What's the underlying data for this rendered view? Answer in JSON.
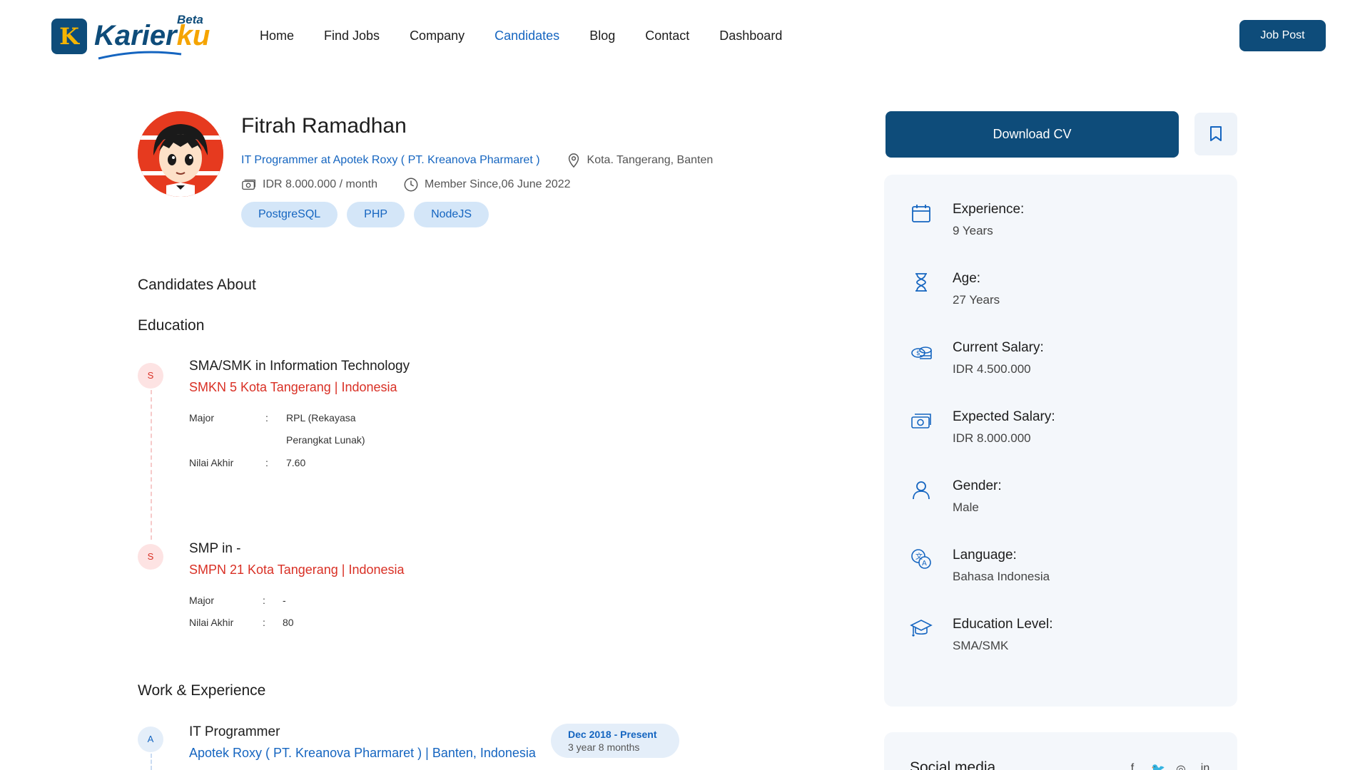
{
  "header": {
    "logo_letter": "K",
    "logo_text_main": "Karier",
    "logo_text_accent": "ku",
    "logo_beta": "Beta",
    "nav": [
      "Home",
      "Find Jobs",
      "Company",
      "Candidates",
      "Blog",
      "Contact",
      "Dashboard"
    ],
    "active_nav": "Candidates",
    "job_post_label": "Job Post"
  },
  "profile": {
    "name": "Fitrah Ramadhan",
    "role": "IT Programmer at Apotek Roxy ( PT. Kreanova Pharmaret )",
    "location": "Kota. Tangerang, Banten",
    "salary": "IDR 8.000.000 / month",
    "member_since": "Member Since,06 June 2022",
    "skills": [
      "PostgreSQL",
      "PHP",
      "NodeJS"
    ]
  },
  "sections": {
    "about": "Candidates About",
    "education": "Education",
    "work": "Work & Experience"
  },
  "education": [
    {
      "dot": "S",
      "title": "SMA/SMK in Information Technology",
      "school": "SMKN 5 Kota Tangerang | Indonesia",
      "major_label": "Major",
      "major_line1": "RPL (Rekayasa",
      "major_line2": "Perangkat Lunak)",
      "grade_label": "Nilai Akhir",
      "grade": "7.60"
    },
    {
      "dot": "S",
      "title": "SMP in -",
      "school": "SMPN 21 Kota Tangerang | Indonesia",
      "major_label": "Major",
      "major": "-",
      "grade_label": "Nilai Akhir",
      "grade": "80"
    }
  ],
  "work": [
    {
      "dot": "A",
      "title": "IT Programmer",
      "company": "Apotek Roxy ( PT. Kreanova Pharmaret ) | Banten, Indonesia",
      "date_range": "Dec 2018 - Present",
      "duration": "3 year 8 months"
    }
  ],
  "actions": {
    "download_cv": "Download CV"
  },
  "overview": [
    {
      "icon": "calendar-icon",
      "label": "Experience:",
      "value": "9 Years"
    },
    {
      "icon": "hourglass-icon",
      "label": "Age:",
      "value": "27 Years"
    },
    {
      "icon": "coins-icon",
      "label": "Current Salary:",
      "value": "IDR 4.500.000"
    },
    {
      "icon": "money-icon",
      "label": "Expected Salary:",
      "value": "IDR 8.000.000"
    },
    {
      "icon": "user-icon",
      "label": "Gender:",
      "value": "Male"
    },
    {
      "icon": "language-icon",
      "label": "Language:",
      "value": "Bahasa Indonesia"
    },
    {
      "icon": "graduation-cap-icon",
      "label": "Education Level:",
      "value": "SMA/SMK"
    }
  ],
  "social": {
    "title": "Social media",
    "icons": [
      "facebook-icon",
      "twitter-icon",
      "instagram-icon",
      "linkedin-icon"
    ],
    "glyphs": [
      "f",
      "🐦",
      "◎",
      "in"
    ]
  },
  "colors": {
    "primary": "#0e4c7a",
    "link": "#1565c0",
    "accent_red": "#d93025",
    "tag_bg": "#d4e6f8",
    "card_bg": "#f4f7fb"
  }
}
